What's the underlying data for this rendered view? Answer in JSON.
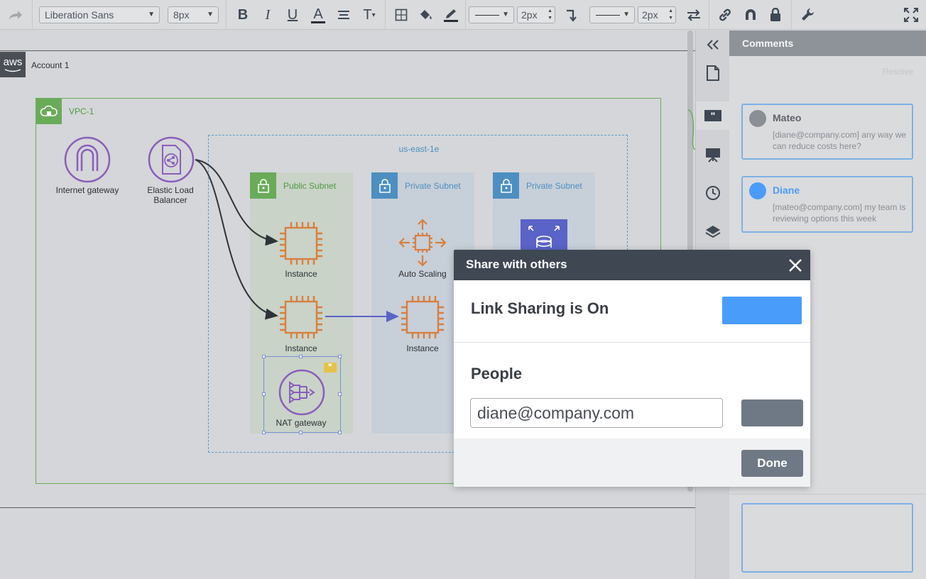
{
  "toolbar": {
    "font_family": "Liberation Sans",
    "font_size": "8px",
    "line_width_1": "2px",
    "line_width_2": "2px",
    "bold_glyph": "B",
    "italic_glyph": "I",
    "underline_glyph": "U",
    "font_color_glyph": "A",
    "text_options_glyph": "T"
  },
  "diagram": {
    "account_label": "Account 1",
    "aws_logo_text": "aws",
    "vpc_label": "VPC-1",
    "region_label": "us-east-1e",
    "internet_gateway_label": "Internet gateway",
    "elb_label_line1": "Elastic Load",
    "elb_label_line2": "Balancer",
    "public_subnet_label": "Public Subnet",
    "private_subnet1_label": "Private Subnet",
    "private_subnet2_label": "Private Subnet",
    "instance1_label": "Instance",
    "instance2_label": "Instance",
    "instance3_label": "Instance",
    "auto_scaling_label": "Auto Scaling",
    "nat_gateway_label": "NAT gateway",
    "colors": {
      "vpc_green": "#6aab5a",
      "subnet_blue": "#4d8fc0",
      "ec2_orange": "#d7803f",
      "network_purple": "#8a5dbb",
      "db_purple": "#5a63c6"
    }
  },
  "comments": {
    "header": "Comments",
    "resolve_label": "Resolve",
    "items": [
      {
        "author": "Mateo",
        "text": "[diane@company.com] any way we can reduce costs here?",
        "author_color": "#5f6368",
        "dot_color": "#8a8f95"
      },
      {
        "author": "Diane",
        "text": "[mateo@company.com] my team is reviewing options this week",
        "author_color": "#4a9cfb",
        "dot_color": "#4a9cfb"
      }
    ]
  },
  "modal": {
    "title": "Share with others",
    "link_sharing_title": "Link Sharing is On",
    "people_title": "People",
    "people_input_value": "diane@company.com",
    "done_label": "Done"
  }
}
